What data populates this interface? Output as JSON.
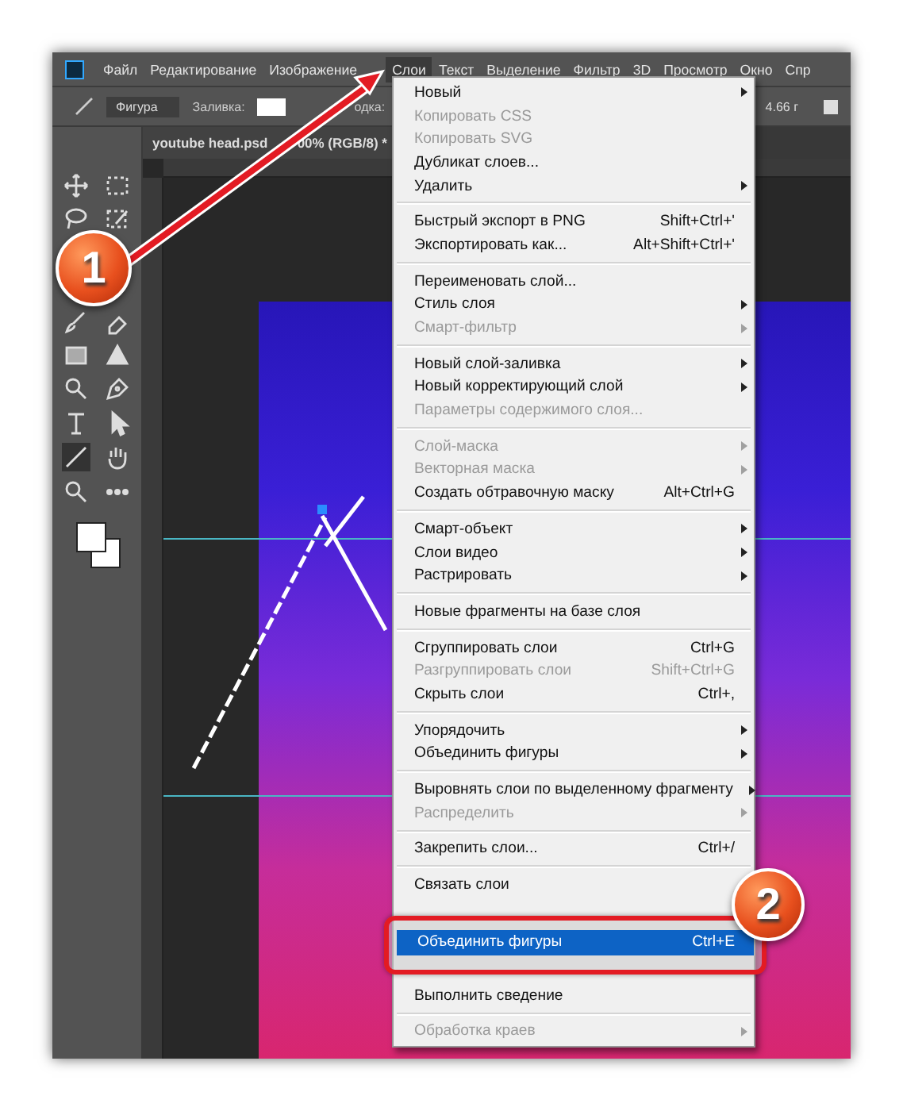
{
  "menubar": {
    "items": [
      {
        "label": "Файл",
        "selected": false
      },
      {
        "label": "Редактирование",
        "selected": false
      },
      {
        "label": "Изображение",
        "selected": false
      },
      {
        "label": "Слои",
        "selected": true
      },
      {
        "label": "Текст",
        "selected": false
      },
      {
        "label": "Выделение",
        "selected": false
      },
      {
        "label": "Фильтр",
        "selected": false
      },
      {
        "label": "3D",
        "selected": false
      },
      {
        "label": "Просмотр",
        "selected": false
      },
      {
        "label": "Окно",
        "selected": false
      },
      {
        "label": "Спр",
        "selected": false
      }
    ]
  },
  "options_bar": {
    "mode": "Фигура",
    "fill_label": "Заливка:",
    "stroke_label": "одка:",
    "value": "4.66 г"
  },
  "document": {
    "tab_title": "youtube head.psd",
    "tab_title_rest": "00% (RGB/8) *"
  },
  "layer_menu": {
    "groups": [
      [
        {
          "label": "Новый",
          "disabled": false,
          "submenu": true,
          "selected": false
        },
        {
          "label": "Копировать CSS",
          "disabled": true,
          "submenu": false,
          "selected": false
        },
        {
          "label": "Копировать SVG",
          "disabled": true,
          "submenu": false,
          "selected": false
        },
        {
          "label": "Дубликат слоев...",
          "disabled": false,
          "submenu": false,
          "selected": false
        },
        {
          "label": "Удалить",
          "disabled": false,
          "submenu": true,
          "selected": false
        }
      ],
      [
        {
          "label": "Быстрый экспорт в PNG",
          "shortcut": "Shift+Ctrl+'",
          "disabled": false,
          "submenu": false,
          "selected": false
        },
        {
          "label": "Экспортировать как...",
          "shortcut": "Alt+Shift+Ctrl+'",
          "disabled": false,
          "submenu": false,
          "selected": false
        }
      ],
      [
        {
          "label": "Переименовать слой...",
          "disabled": false,
          "submenu": false,
          "selected": false
        },
        {
          "label": "Стиль слоя",
          "disabled": false,
          "submenu": true,
          "selected": false
        },
        {
          "label": "Смарт-фильтр",
          "disabled": true,
          "submenu": true,
          "selected": false
        }
      ],
      [
        {
          "label": "Новый слой-заливка",
          "disabled": false,
          "submenu": true,
          "selected": false
        },
        {
          "label": "Новый корректирующий слой",
          "disabled": false,
          "submenu": true,
          "selected": false
        },
        {
          "label": "Параметры содержимого слоя...",
          "disabled": true,
          "submenu": false,
          "selected": false
        }
      ],
      [
        {
          "label": "Слой-маска",
          "disabled": true,
          "submenu": true,
          "selected": false
        },
        {
          "label": "Векторная маска",
          "disabled": true,
          "submenu": true,
          "selected": false
        },
        {
          "label": "Создать обтравочную маску",
          "shortcut": "Alt+Ctrl+G",
          "disabled": false,
          "submenu": false,
          "selected": false
        }
      ],
      [
        {
          "label": "Смарт-объект",
          "disabled": false,
          "submenu": true,
          "selected": false
        },
        {
          "label": "Слои видео",
          "disabled": false,
          "submenu": true,
          "selected": false
        },
        {
          "label": "Растрировать",
          "disabled": false,
          "submenu": true,
          "selected": false
        }
      ],
      [
        {
          "label": "Новые фрагменты на базе слоя",
          "disabled": false,
          "submenu": false,
          "selected": false
        }
      ],
      [
        {
          "label": "Сгруппировать слои",
          "shortcut": "Ctrl+G",
          "disabled": false,
          "submenu": false,
          "selected": false
        },
        {
          "label": "Разгруппировать слои",
          "shortcut": "Shift+Ctrl+G",
          "disabled": true,
          "submenu": false,
          "selected": false
        },
        {
          "label": "Скрыть слои",
          "shortcut": "Ctrl+,",
          "disabled": false,
          "submenu": false,
          "selected": false
        }
      ],
      [
        {
          "label": "Упорядочить",
          "disabled": false,
          "submenu": true,
          "selected": false
        },
        {
          "label": "Объединить фигуры",
          "disabled": false,
          "submenu": true,
          "selected": false
        }
      ],
      [
        {
          "label": "Выровнять слои по выделенному фрагменту",
          "disabled": false,
          "submenu": true,
          "selected": false
        },
        {
          "label": "Распределить",
          "disabled": true,
          "submenu": true,
          "selected": false
        }
      ],
      [
        {
          "label": "Закрепить слои...",
          "shortcut": "Ctrl+/",
          "disabled": false,
          "submenu": false,
          "selected": false
        }
      ],
      [
        {
          "label": "Связать слои",
          "disabled": false,
          "submenu": false,
          "selected": false
        },
        {
          "label": "Объединить фигуры",
          "shortcut": "Ctrl+E",
          "disabled": false,
          "submenu": false,
          "selected": true
        },
        {
          "label": "Выполнить сведение",
          "disabled": false,
          "submenu": false,
          "selected": false
        }
      ],
      [
        {
          "label": "Обработка краев",
          "disabled": true,
          "submenu": true,
          "selected": false
        }
      ]
    ]
  },
  "callouts": [
    {
      "number": "1"
    },
    {
      "number": "2"
    }
  ]
}
